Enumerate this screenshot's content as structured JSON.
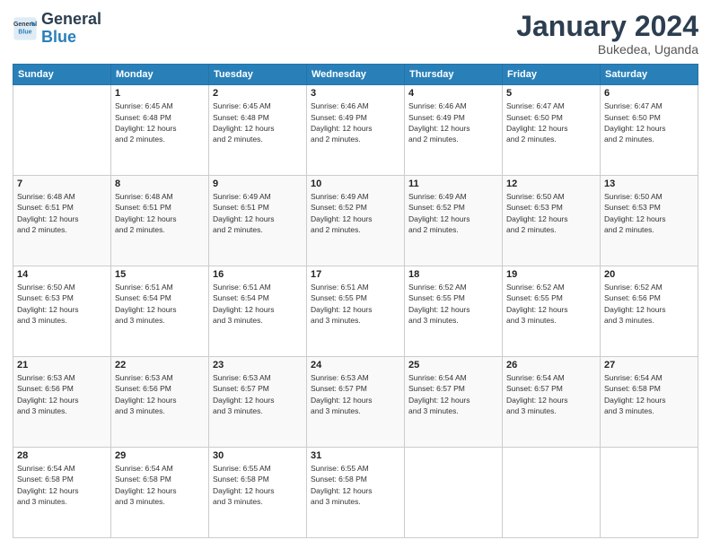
{
  "logo": {
    "line1": "General",
    "line2": "Blue"
  },
  "title": "January 2024",
  "subtitle": "Bukedea, Uganda",
  "header_days": [
    "Sunday",
    "Monday",
    "Tuesday",
    "Wednesday",
    "Thursday",
    "Friday",
    "Saturday"
  ],
  "weeks": [
    [
      {
        "num": "",
        "info": ""
      },
      {
        "num": "1",
        "info": "Sunrise: 6:45 AM\nSunset: 6:48 PM\nDaylight: 12 hours\nand 2 minutes."
      },
      {
        "num": "2",
        "info": "Sunrise: 6:45 AM\nSunset: 6:48 PM\nDaylight: 12 hours\nand 2 minutes."
      },
      {
        "num": "3",
        "info": "Sunrise: 6:46 AM\nSunset: 6:49 PM\nDaylight: 12 hours\nand 2 minutes."
      },
      {
        "num": "4",
        "info": "Sunrise: 6:46 AM\nSunset: 6:49 PM\nDaylight: 12 hours\nand 2 minutes."
      },
      {
        "num": "5",
        "info": "Sunrise: 6:47 AM\nSunset: 6:50 PM\nDaylight: 12 hours\nand 2 minutes."
      },
      {
        "num": "6",
        "info": "Sunrise: 6:47 AM\nSunset: 6:50 PM\nDaylight: 12 hours\nand 2 minutes."
      }
    ],
    [
      {
        "num": "7",
        "info": "Sunrise: 6:48 AM\nSunset: 6:51 PM\nDaylight: 12 hours\nand 2 minutes."
      },
      {
        "num": "8",
        "info": "Sunrise: 6:48 AM\nSunset: 6:51 PM\nDaylight: 12 hours\nand 2 minutes."
      },
      {
        "num": "9",
        "info": "Sunrise: 6:49 AM\nSunset: 6:51 PM\nDaylight: 12 hours\nand 2 minutes."
      },
      {
        "num": "10",
        "info": "Sunrise: 6:49 AM\nSunset: 6:52 PM\nDaylight: 12 hours\nand 2 minutes."
      },
      {
        "num": "11",
        "info": "Sunrise: 6:49 AM\nSunset: 6:52 PM\nDaylight: 12 hours\nand 2 minutes."
      },
      {
        "num": "12",
        "info": "Sunrise: 6:50 AM\nSunset: 6:53 PM\nDaylight: 12 hours\nand 2 minutes."
      },
      {
        "num": "13",
        "info": "Sunrise: 6:50 AM\nSunset: 6:53 PM\nDaylight: 12 hours\nand 2 minutes."
      }
    ],
    [
      {
        "num": "14",
        "info": "Sunrise: 6:50 AM\nSunset: 6:53 PM\nDaylight: 12 hours\nand 3 minutes."
      },
      {
        "num": "15",
        "info": "Sunrise: 6:51 AM\nSunset: 6:54 PM\nDaylight: 12 hours\nand 3 minutes."
      },
      {
        "num": "16",
        "info": "Sunrise: 6:51 AM\nSunset: 6:54 PM\nDaylight: 12 hours\nand 3 minutes."
      },
      {
        "num": "17",
        "info": "Sunrise: 6:51 AM\nSunset: 6:55 PM\nDaylight: 12 hours\nand 3 minutes."
      },
      {
        "num": "18",
        "info": "Sunrise: 6:52 AM\nSunset: 6:55 PM\nDaylight: 12 hours\nand 3 minutes."
      },
      {
        "num": "19",
        "info": "Sunrise: 6:52 AM\nSunset: 6:55 PM\nDaylight: 12 hours\nand 3 minutes."
      },
      {
        "num": "20",
        "info": "Sunrise: 6:52 AM\nSunset: 6:56 PM\nDaylight: 12 hours\nand 3 minutes."
      }
    ],
    [
      {
        "num": "21",
        "info": "Sunrise: 6:53 AM\nSunset: 6:56 PM\nDaylight: 12 hours\nand 3 minutes."
      },
      {
        "num": "22",
        "info": "Sunrise: 6:53 AM\nSunset: 6:56 PM\nDaylight: 12 hours\nand 3 minutes."
      },
      {
        "num": "23",
        "info": "Sunrise: 6:53 AM\nSunset: 6:57 PM\nDaylight: 12 hours\nand 3 minutes."
      },
      {
        "num": "24",
        "info": "Sunrise: 6:53 AM\nSunset: 6:57 PM\nDaylight: 12 hours\nand 3 minutes."
      },
      {
        "num": "25",
        "info": "Sunrise: 6:54 AM\nSunset: 6:57 PM\nDaylight: 12 hours\nand 3 minutes."
      },
      {
        "num": "26",
        "info": "Sunrise: 6:54 AM\nSunset: 6:57 PM\nDaylight: 12 hours\nand 3 minutes."
      },
      {
        "num": "27",
        "info": "Sunrise: 6:54 AM\nSunset: 6:58 PM\nDaylight: 12 hours\nand 3 minutes."
      }
    ],
    [
      {
        "num": "28",
        "info": "Sunrise: 6:54 AM\nSunset: 6:58 PM\nDaylight: 12 hours\nand 3 minutes."
      },
      {
        "num": "29",
        "info": "Sunrise: 6:54 AM\nSunset: 6:58 PM\nDaylight: 12 hours\nand 3 minutes."
      },
      {
        "num": "30",
        "info": "Sunrise: 6:55 AM\nSunset: 6:58 PM\nDaylight: 12 hours\nand 3 minutes."
      },
      {
        "num": "31",
        "info": "Sunrise: 6:55 AM\nSunset: 6:58 PM\nDaylight: 12 hours\nand 3 minutes."
      },
      {
        "num": "",
        "info": ""
      },
      {
        "num": "",
        "info": ""
      },
      {
        "num": "",
        "info": ""
      }
    ]
  ]
}
